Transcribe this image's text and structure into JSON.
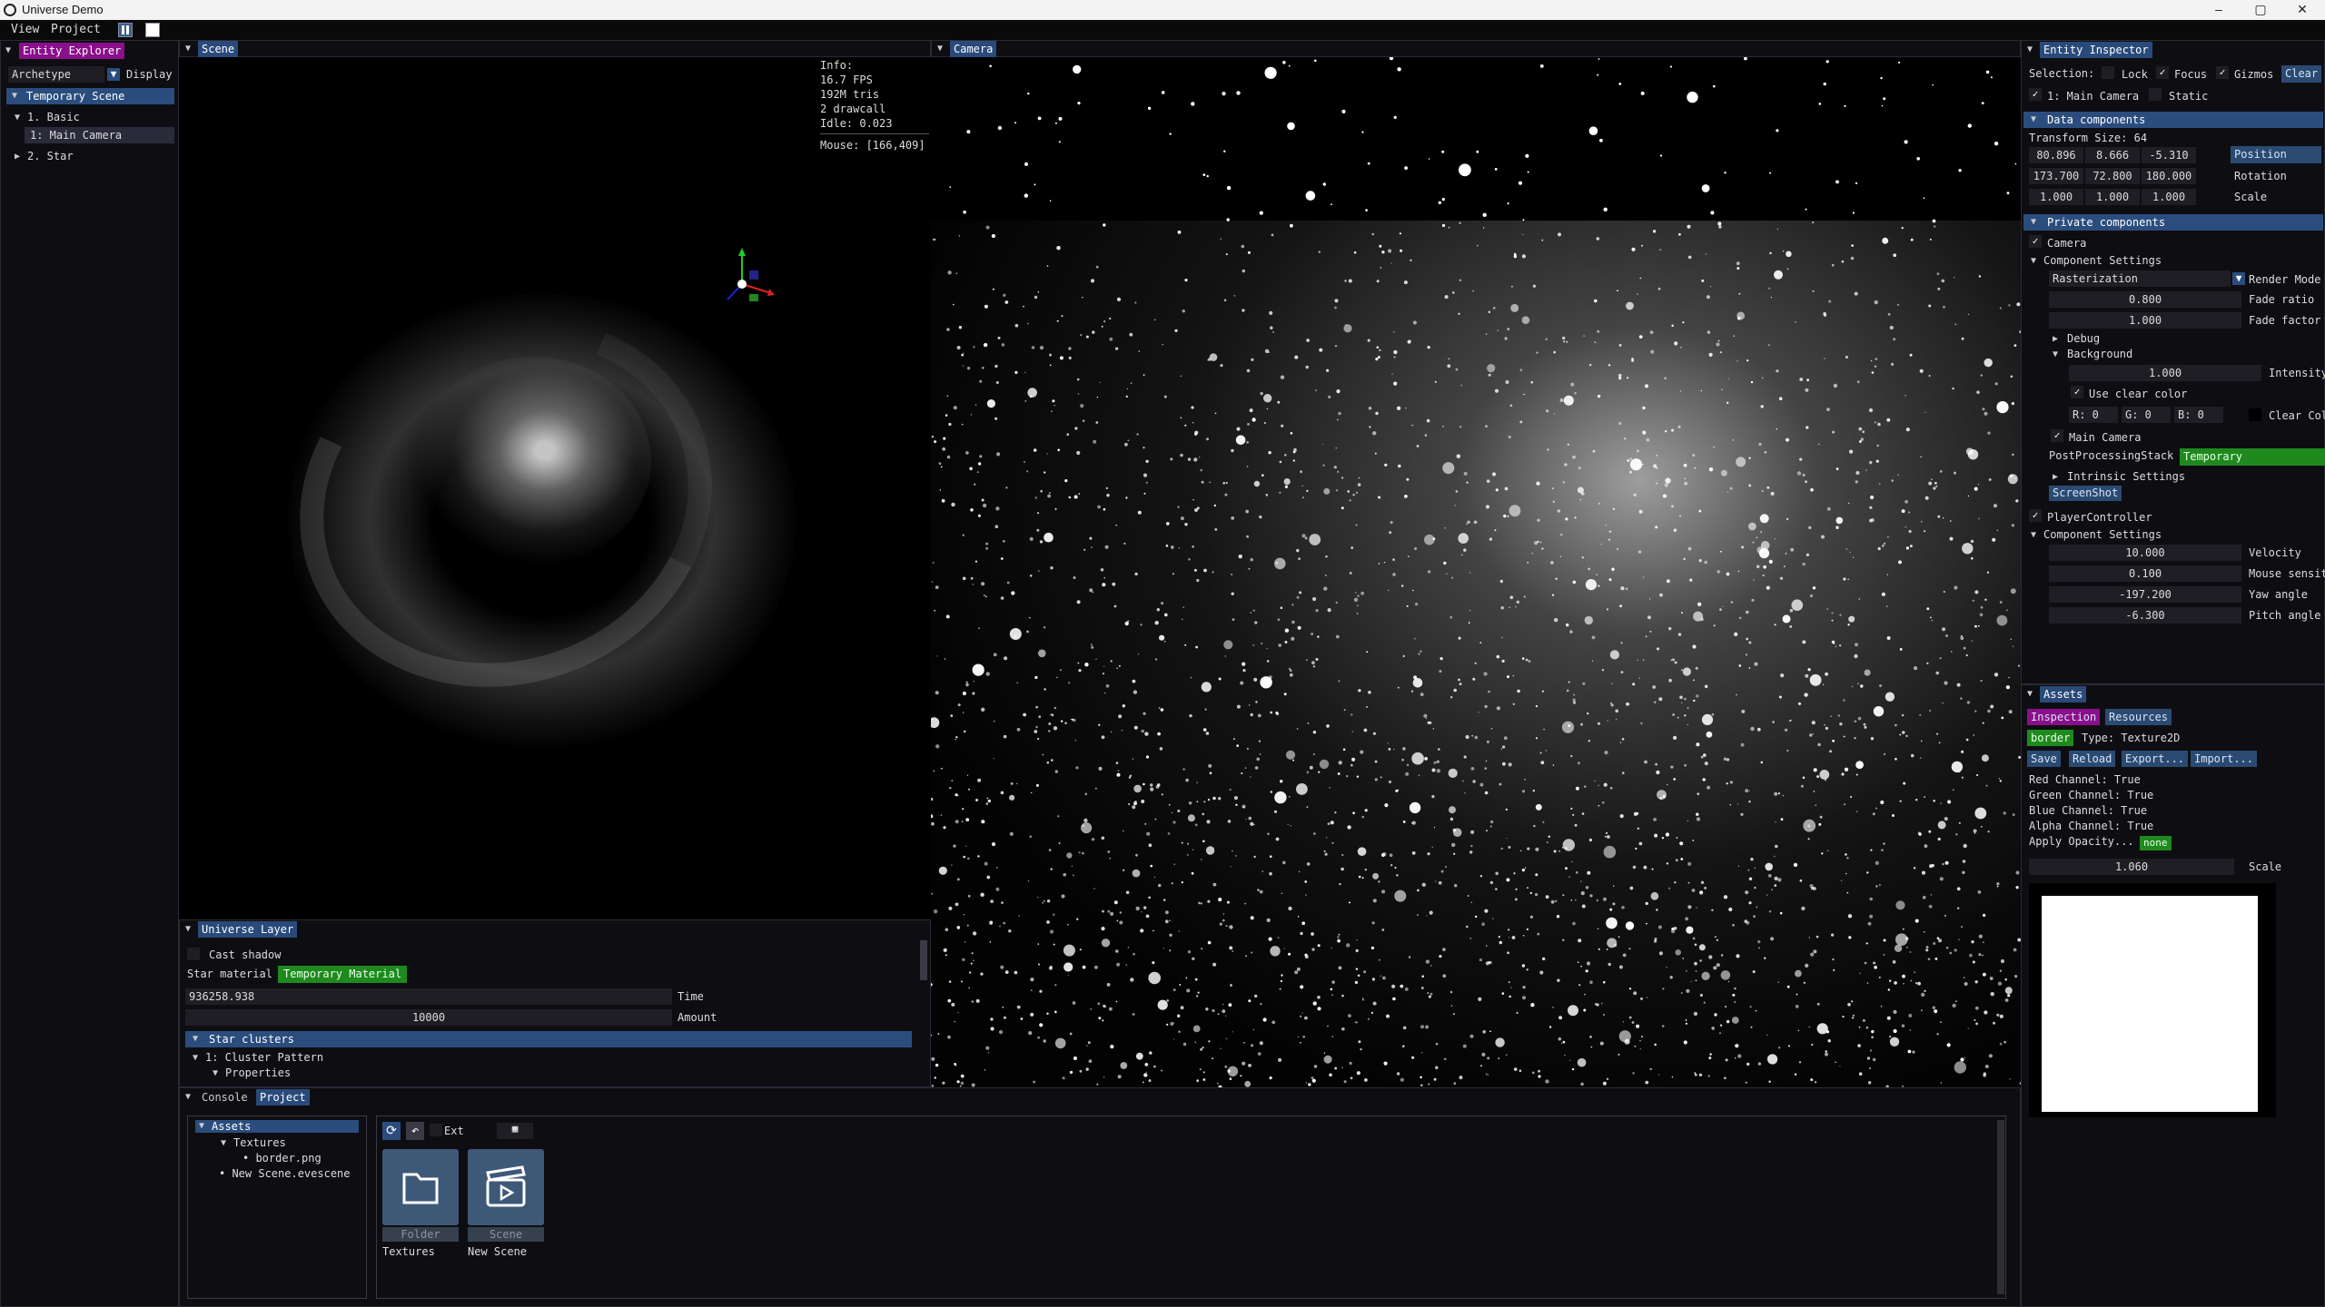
{
  "window": {
    "title": "Universe Demo",
    "controls": [
      "–",
      "▢",
      "✕"
    ]
  },
  "menu": {
    "items": [
      "View",
      "Project"
    ],
    "toolbar": [
      "pause-icon",
      "stop-icon"
    ]
  },
  "explorer": {
    "tab": "Entity Explorer",
    "filter_label": "Archetype",
    "display_label": "Display",
    "scene": "Temporary Scene",
    "tree": [
      {
        "label": "1. Basic",
        "expanded": true
      },
      {
        "label": "1: Main Camera",
        "selected": true
      },
      {
        "label": "2. Star",
        "expanded": false
      }
    ]
  },
  "scene": {
    "tab": "Scene",
    "info": [
      "Info:",
      "16.7 FPS",
      "192M tris",
      "2 drawcall",
      "Idle: 0.023"
    ],
    "mouse": "Mouse: [166,409]"
  },
  "camera": {
    "tab": "Camera"
  },
  "universe_layer": {
    "tab": "Universe Layer",
    "cast_shadow": "Cast shadow",
    "star_material_label": "Star material",
    "star_material_value": "Temporary Material",
    "time_value": "936258.938",
    "time_label": "Time",
    "amount_value": "10000",
    "amount_label": "Amount",
    "section": "Star clusters",
    "cluster": "1: Cluster Pattern",
    "properties": "Properties"
  },
  "bottom": {
    "tabs": [
      "Console",
      "Project"
    ],
    "tree": {
      "root": "Assets",
      "textures": "Textures",
      "border": "border.png",
      "new_scene": "New Scene.evescene"
    },
    "toolbar": {
      "ext_label": "Ext"
    },
    "files": [
      {
        "type": "Folder",
        "name": "Textures",
        "icon": "folder-icon"
      },
      {
        "type": "Scene",
        "name": "New Scene",
        "icon": "scene-icon"
      }
    ]
  },
  "inspector": {
    "tab": "Entity Inspector",
    "selection_label": "Selection:",
    "lock": "Lock",
    "focus": "Focus",
    "gizmos": "Gizmos",
    "clear": "Clear",
    "entity": "1: Main Camera",
    "static": "Static",
    "data_components": "Data components",
    "transform_size": "Transform Size: 64",
    "position": [
      "80.896",
      "8.666",
      "-5.310"
    ],
    "position_label": "Position",
    "rotation": [
      "173.700",
      "72.800",
      "180.000"
    ],
    "rotation_label": "Rotation",
    "scale": [
      "1.000",
      "1.000",
      "1.000"
    ],
    "scale_label": "Scale",
    "private_components": "Private components",
    "camera": "Camera",
    "component_settings": "Component Settings",
    "render_mode_value": "Rasterization",
    "render_mode_label": "Render Mode",
    "fade_ratio_value": "0.800",
    "fade_ratio_label": "Fade ratio",
    "fade_factor_value": "1.000",
    "fade_factor_label": "Fade factor",
    "debug": "Debug",
    "background": "Background",
    "intensity_value": "1.000",
    "intensity_label": "Intensity",
    "use_clear_color": "Use clear color",
    "rgb": [
      "R:  0",
      "G:  0",
      "B:  0"
    ],
    "clear_color": "Clear Col",
    "main_camera": "Main Camera",
    "pps_label": "PostProcessingStack",
    "pps_value": "Temporary PostProcessi",
    "intrinsic": "Intrinsic Settings",
    "screenshot": "ScreenShot",
    "player_controller": "PlayerController",
    "component_settings2": "Component Settings",
    "velocity_value": "10.000",
    "velocity_label": "Velocity",
    "mouse_value": "0.100",
    "mouse_label": "Mouse sensit",
    "yaw_value": "-197.200",
    "yaw_label": "Yaw angle",
    "pitch_value": "-6.300",
    "pitch_label": "Pitch angle"
  },
  "assets": {
    "tab": "Assets",
    "inspection": "Inspection",
    "resources": "Resources",
    "name": "border",
    "type": "Type: Texture2D",
    "buttons": [
      "Save",
      "Reload",
      "Export...",
      "Import..."
    ],
    "red": "Red Channel: True",
    "green": "Green Channel: True",
    "blue": "Blue Channel: True",
    "alpha": "Alpha Channel: True",
    "apply_opacity": "Apply Opacity...",
    "opacity_value": "none",
    "scale_value": "1.060",
    "scale_label": "Scale"
  }
}
